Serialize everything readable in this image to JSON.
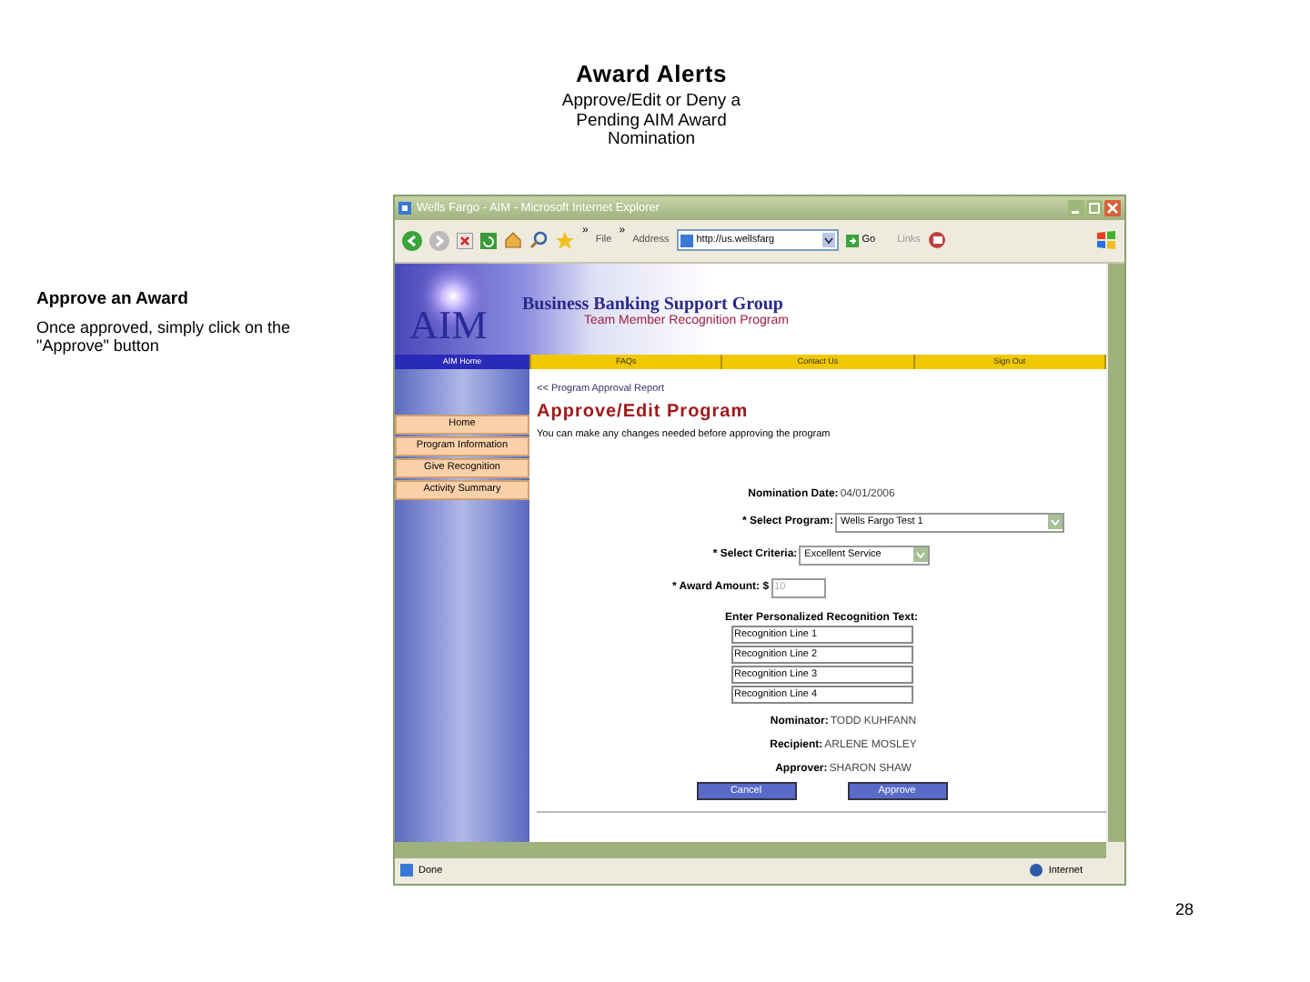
{
  "slide": {
    "title": "Award Alerts",
    "subtitle_lines": [
      "Approve/Edit or Deny a",
      "Pending AIM Award",
      "Nomination"
    ],
    "note_heading": "Approve an Award",
    "note_text": "Once approved, simply click on the \"Approve\" button",
    "page_number": "28"
  },
  "browser": {
    "title": "Wells Fargo - AIM - Microsoft Internet Explorer",
    "toolbar_more": "»",
    "file_menu": "File",
    "address_label": "Address",
    "address": "http://us.wellsfarg",
    "go": "Go",
    "links": "Links",
    "status": "Done",
    "zone": "Internet"
  },
  "site": {
    "logo": "AIM",
    "group": "Business Banking Support Group",
    "program": "Team Member Recognition Program",
    "nav": [
      {
        "label": "AIM Home",
        "selected": true
      },
      {
        "label": "FAQs",
        "selected": false
      },
      {
        "label": "Contact Us",
        "selected": false
      },
      {
        "label": "Sign Out",
        "selected": false
      }
    ],
    "menu": [
      "Home",
      "Program Information",
      "Give Recognition",
      "Activity Summary"
    ],
    "breadcrumb": "<< Program Approval Report",
    "heading": "Approve/Edit Program",
    "description": "You can make any changes needed before approving the program",
    "nomination_label": "Nomination Date:",
    "nomination_date": "04/01/2006",
    "fields": [
      {
        "label": "* Select Program:",
        "kind": "select",
        "value": "Wells Fargo Test 1"
      },
      {
        "label": "* Select Criteria:",
        "kind": "select",
        "value": "Excellent Service"
      },
      {
        "label": "* Award Amount: $",
        "kind": "text",
        "value": "10"
      }
    ],
    "text_label": "Enter Personalized Recognition Text:",
    "text_lines": [
      "Recognition Line 1",
      "Recognition Line 2",
      "Recognition Line 3",
      "Recognition Line 4"
    ],
    "people": [
      {
        "label": "Nominator:",
        "value": "TODD KUHFANN"
      },
      {
        "label": "Recipient:",
        "value": "ARLENE MOSLEY"
      },
      {
        "label": "Approver:",
        "value": "SHARON SHAW"
      }
    ],
    "buttons": [
      "Cancel",
      "Approve"
    ]
  }
}
